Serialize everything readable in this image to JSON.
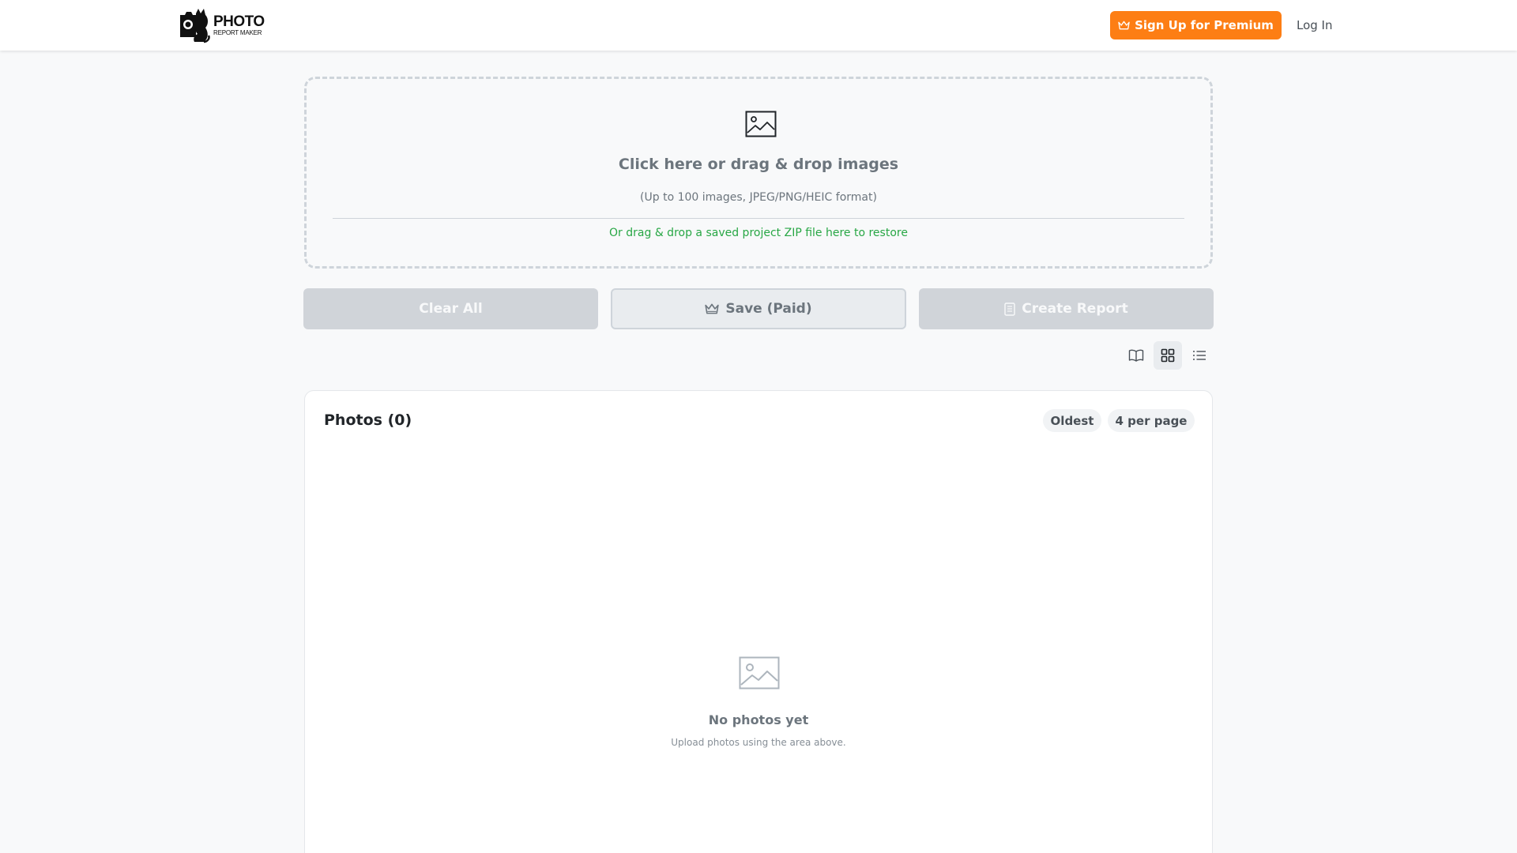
{
  "header": {
    "logo": {
      "primary": "PHOTO",
      "secondary": "REPORT MAKER"
    },
    "premium_label": "Sign Up for Premium",
    "login_label": "Log In"
  },
  "upload": {
    "title": "Click here or drag & drop images",
    "subtitle": "(Up to 100 images, JPEG/PNG/HEIC format)",
    "zip_hint": "Or drag & drop a saved project ZIP file here to restore"
  },
  "actions": {
    "clear_label": "Clear All",
    "save_label": "Save (Paid)",
    "create_label": "Create Report"
  },
  "view_modes": [
    "book-icon",
    "grid-icon",
    "list-icon"
  ],
  "photos": {
    "title": "Photos (0)",
    "sort_label": "Oldest",
    "per_page_label": "4 per page",
    "empty_title": "No photos yet",
    "empty_subtitle": "Upload photos using the area above."
  },
  "colors": {
    "accent": "#fd7e14",
    "success": "#28a745",
    "muted": "#6c757d",
    "disabled": "#d0d4d9"
  }
}
